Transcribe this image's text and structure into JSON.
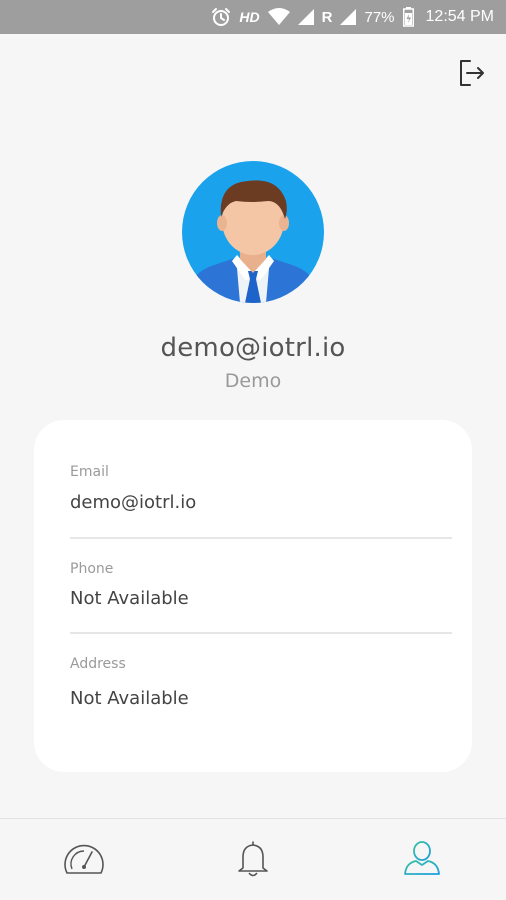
{
  "status_bar": {
    "network_type": "HD",
    "roaming": "R",
    "battery": "77%",
    "time": "12:54 PM",
    "icons": [
      "alarm-icon",
      "wifi-icon",
      "signal-icon",
      "battery-icon"
    ]
  },
  "header": {
    "logout_icon": "logout-icon"
  },
  "profile": {
    "avatar_icon": "user-avatar",
    "email": "demo@iotrl.io",
    "name": "Demo"
  },
  "details": {
    "email_label": "Email",
    "email_value": "demo@iotrl.io",
    "phone_label": "Phone",
    "phone_value": "Not Available",
    "address_label": "Address",
    "address_value": "Not Available"
  },
  "bottom_nav": {
    "items": [
      {
        "icon": "dashboard-gauge-icon",
        "active": false
      },
      {
        "icon": "bell-icon",
        "active": false
      },
      {
        "icon": "profile-icon",
        "active": true
      }
    ],
    "active_color": "#1bb7c4",
    "inactive_color": "#555555"
  },
  "colors": {
    "avatar_bg": "#1aa3ec",
    "status_bar_bg": "#9e9e9e",
    "page_bg": "#f6f6f7"
  }
}
